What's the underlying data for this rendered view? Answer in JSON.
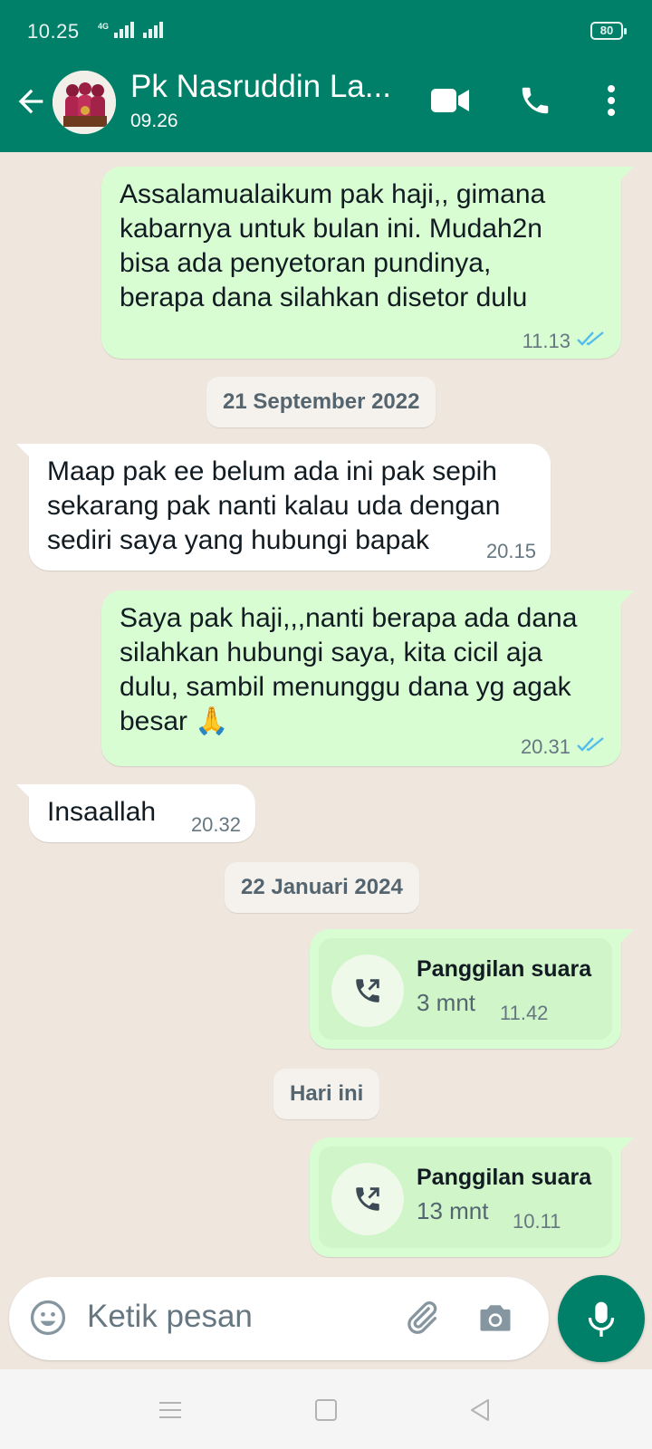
{
  "status_bar": {
    "time": "10.25",
    "network": "4G",
    "battery": "80",
    "icons": [
      "signal-icon",
      "battery-icon"
    ]
  },
  "header": {
    "contact_name": "Pk Nasruddin La...",
    "last_seen": "09.26",
    "icons": [
      "back-arrow-icon",
      "video-call-icon",
      "voice-call-icon",
      "more-options-icon"
    ]
  },
  "colors": {
    "header": "#008069",
    "outgoing_bubble": "#d9fdd3",
    "incoming_bubble": "#ffffff",
    "chat_background": "#efe7de",
    "read_ticks": "#53bdeb"
  },
  "messages": [
    {
      "type": "outgoing",
      "text": "Assalamualaikum pak haji,, gimana\nkabarnya untuk bulan ini. Mudah2n\nbisa ada penyetoran pundinya,\nberapa dana silahkan disetor dulu",
      "time": "11.13",
      "status": "read"
    },
    {
      "type": "date",
      "text": "21 September 2022"
    },
    {
      "type": "incoming",
      "text": "Maap pak ee belum ada ini pak sepih\nsekarang pak nanti kalau uda dengan\nsediri saya yang hubungi bapak",
      "time": "20.15"
    },
    {
      "type": "outgoing",
      "text": "Saya pak haji,,,nanti berapa ada dana\nsilahkan hubungi saya, kita cicil aja\ndulu, sambil menunggu dana yg agak\nbesar 🙏",
      "time": "20.31",
      "status": "read"
    },
    {
      "type": "incoming",
      "text": "Insaallah",
      "time": "20.32"
    },
    {
      "type": "date",
      "text": "22 Januari 2024"
    },
    {
      "type": "call",
      "title": "Panggilan suara",
      "duration": "3 mnt",
      "time": "11.42",
      "icon": "outgoing-call-icon"
    },
    {
      "type": "date",
      "text": "Hari ini"
    },
    {
      "type": "call",
      "title": "Panggilan suara",
      "duration": "13 mnt",
      "time": "10.11",
      "icon": "outgoing-call-icon"
    }
  ],
  "composer": {
    "placeholder": "Ketik pesan",
    "icons": [
      "emoji-icon",
      "attach-icon",
      "camera-icon",
      "mic-icon"
    ]
  },
  "nav_bar": {
    "icons": [
      "menu-icon",
      "home-icon",
      "back-icon"
    ]
  }
}
